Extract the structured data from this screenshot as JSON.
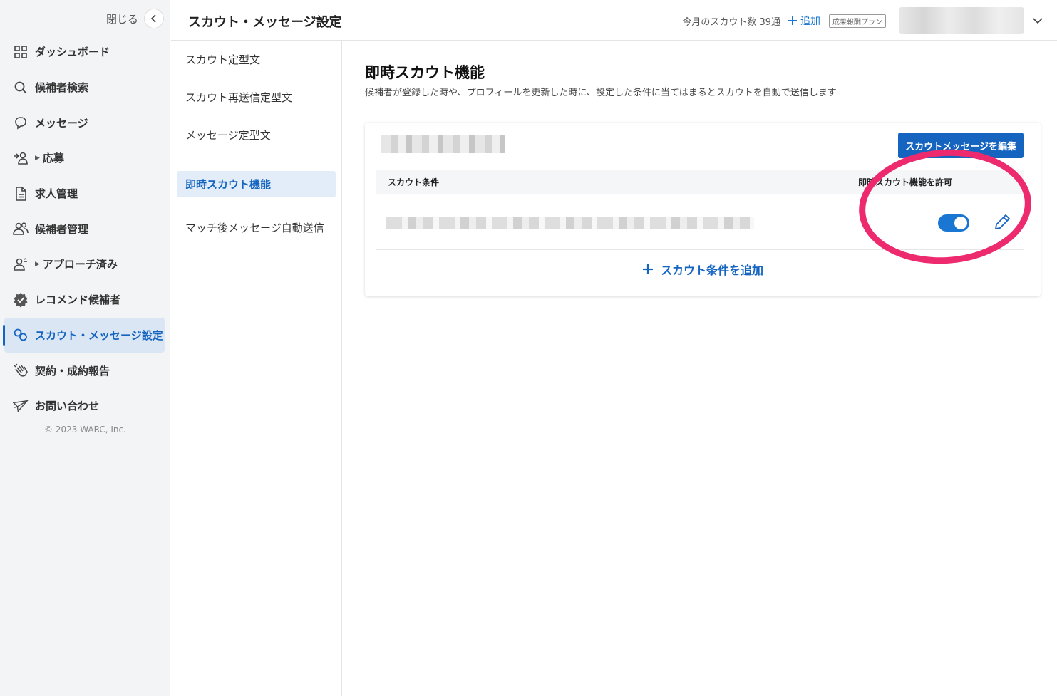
{
  "sidebar": {
    "close_label": "閉じる",
    "items": [
      {
        "label": "ダッシュボード",
        "icon": "grid-icon"
      },
      {
        "label": "候補者検索",
        "icon": "search-icon"
      },
      {
        "label": "メッセージ",
        "icon": "chat-bubble-icon"
      },
      {
        "label": "応募",
        "icon": "person-arrow-icon"
      },
      {
        "label": "求人管理",
        "icon": "document-icon"
      },
      {
        "label": "候補者管理",
        "icon": "people-icon"
      },
      {
        "label": "アプローチ済み",
        "icon": "person-approach-icon"
      },
      {
        "label": "レコメンド候補者",
        "icon": "verified-badge-icon"
      },
      {
        "label": "スカウト・メッセージ設定",
        "icon": "link-settings-icon"
      },
      {
        "label": "契約・成約報告",
        "icon": "clap-hands-icon"
      },
      {
        "label": "お問い合わせ",
        "icon": "paper-plane-icon"
      }
    ],
    "copyright": "© 2023 WARC, Inc."
  },
  "header": {
    "title": "スカウト・メッセージ設定",
    "scout_count": "今月のスカウト数 39通",
    "add_label": "追加",
    "plan_badge": "成果報酬プラン"
  },
  "subnav": {
    "items": [
      "スカウト定型文",
      "スカウト再送信定型文",
      "メッセージ定型文",
      "即時スカウト機能",
      "マッチ後メッセージ自動送信"
    ]
  },
  "main": {
    "title": "即時スカウト機能",
    "description": "候補者が登録した時や、プロフィールを更新した時に、設定した条件に当てはまるとスカウトを自動で送信します",
    "card": {
      "edit_button": "スカウトメッセージを編集",
      "col_condition": "スカウト条件",
      "col_allow": "即時スカウト機能を許可",
      "toggle_on": true,
      "add_condition": "スカウト条件を追加"
    }
  },
  "colors": {
    "accent": "#1565c0",
    "toggle": "#1976d2",
    "highlight": "#ee2a6f",
    "active_bg": "#dbe6f5"
  }
}
